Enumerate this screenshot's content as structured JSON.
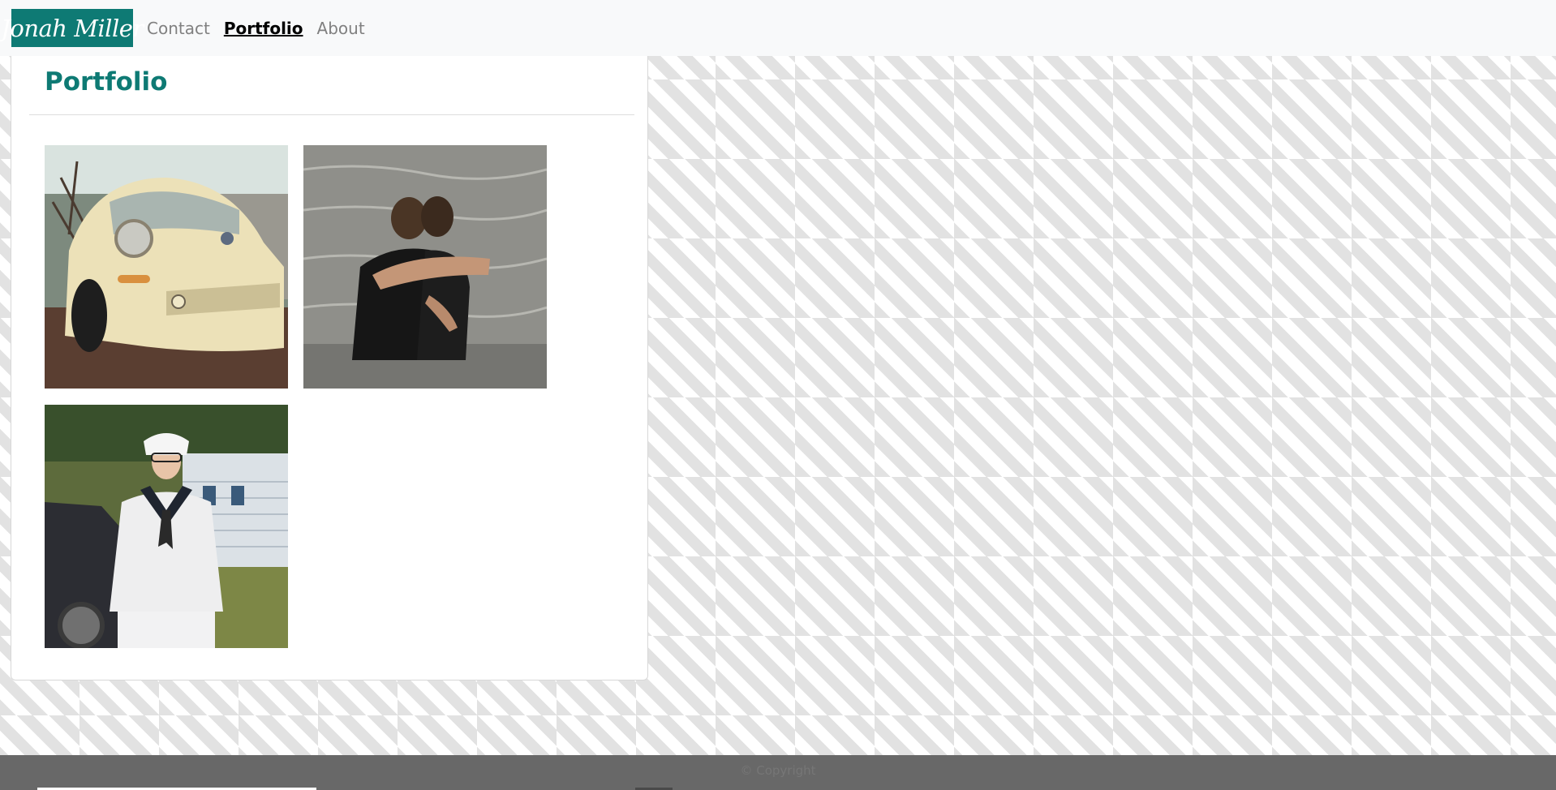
{
  "navbar": {
    "brand": "Jonah Miller",
    "links": [
      {
        "label": "Contact",
        "active": false
      },
      {
        "label": "Portfolio",
        "active": true
      },
      {
        "label": "About",
        "active": false
      }
    ]
  },
  "main": {
    "title": "Portfolio",
    "photos": [
      {
        "subject": "cream-colored car"
      },
      {
        "subject": "two people embracing in water"
      },
      {
        "subject": "person in white sailor uniform"
      }
    ]
  },
  "footer": {
    "text": "© Copyright"
  },
  "colors": {
    "brand": "#0e7a74",
    "navbar_bg": "#f8f9fa",
    "footer_bg": "#686868",
    "pattern": "#e2e2e2"
  }
}
